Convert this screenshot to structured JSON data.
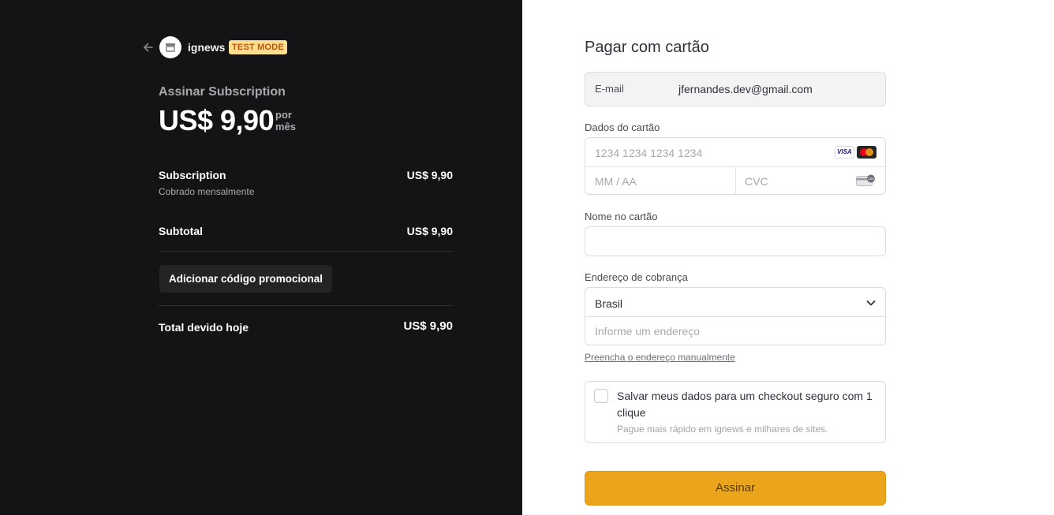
{
  "summary": {
    "back_icon": "arrow-left-icon",
    "store_icon": "store-icon",
    "brand": "ignews",
    "badge": "TEST MODE",
    "subscribe_title": "Assinar Subscription",
    "price": "US$ 9,90",
    "period": "por mês",
    "line_item": {
      "name": "Subscription",
      "description": "Cobrado mensalmente",
      "amount": "US$ 9,90"
    },
    "subtotal_label": "Subtotal",
    "subtotal_value": "US$ 9,90",
    "promo_button": "Adicionar código promocional",
    "total_label": "Total devido hoje",
    "total_value": "US$ 9,90"
  },
  "payment": {
    "title": "Pagar com cartão",
    "email_label": "E-mail",
    "email_value": "jfernandes.dev@gmail.com",
    "card_label": "Dados do cartão",
    "card_number_placeholder": "1234 1234 1234 1234",
    "card_brands": [
      "VISA",
      "mastercard"
    ],
    "expiry_placeholder": "MM / AA",
    "cvc_placeholder": "CVC",
    "name_label": "Nome no cartão",
    "name_value": "",
    "address_label": "Endereço de cobrança",
    "country_value": "Brasil",
    "address_placeholder": "Informe um endereço",
    "manual_address_link": "Preencha o endereço manualmente",
    "save_label": "Salvar meus dados para um checkout seguro com 1 clique",
    "save_sub": "Pague mais rápido em ignews e milhares de sites.",
    "submit": "Assinar"
  },
  "colors": {
    "left_bg": "#141416",
    "badge_bg": "#ffde92",
    "badge_text": "#bb5504",
    "button_bg": "#eaa51d"
  }
}
